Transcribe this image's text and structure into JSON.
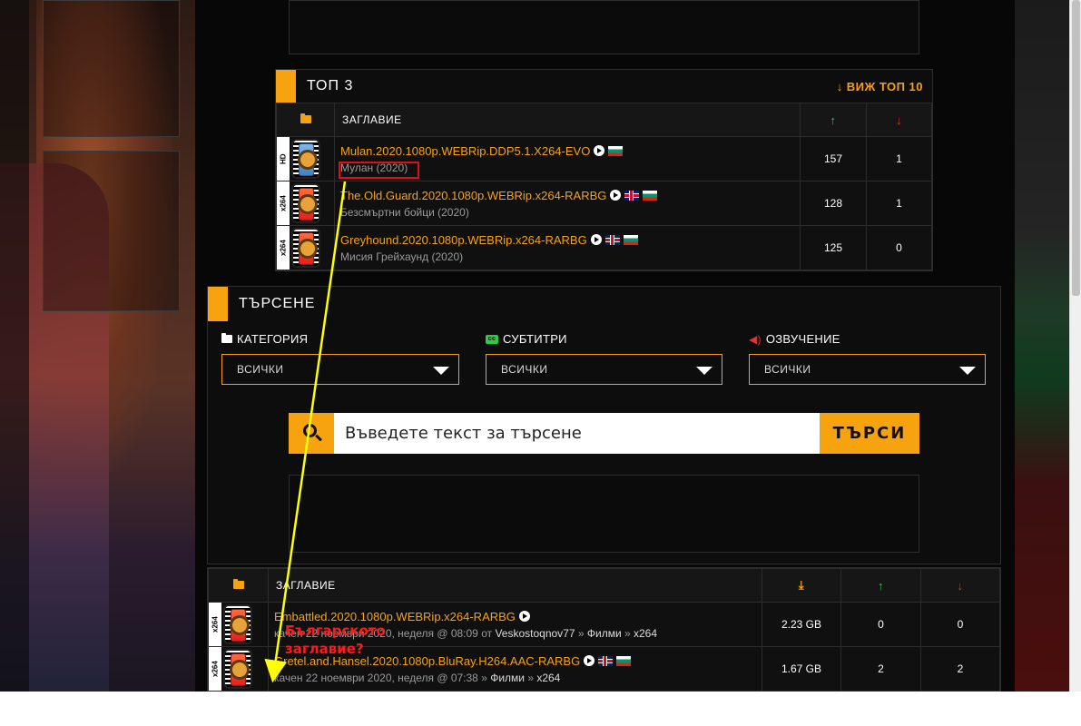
{
  "top3": {
    "title": "ТОП 3",
    "view_top10": "ВИЖ ТОП 10",
    "col_title": "ЗАГЛАВИЕ",
    "rows": [
      {
        "tag": "HD",
        "name": "Mulan.2020.1080p.WEBRip.DDP5.1.X264-EVO",
        "subtitle": "Мулан (2020)",
        "seeders": "157",
        "leechers": "1",
        "flags": [
          "bg"
        ]
      },
      {
        "tag": "x264",
        "name": "The.Old.Guard.2020.1080p.WEBRip.x264-RARBG",
        "subtitle": "Безсмъртни бойци (2020)",
        "seeders": "128",
        "leechers": "1",
        "flags": [
          "uk",
          "bg"
        ]
      },
      {
        "tag": "x264",
        "name": "Greyhound.2020.1080p.WEBRip.x264-RARBG",
        "subtitle": "Мисия Грейхаунд (2020)",
        "seeders": "125",
        "leechers": "0",
        "flags": [
          "uk",
          "bg"
        ]
      }
    ]
  },
  "search": {
    "title": "ТЪРСЕНЕ",
    "category_label": "КАТЕГОРИЯ",
    "subtitles_label": "СУБТИТРИ",
    "audio_label": "ОЗВУЧЕНИЕ",
    "category_value": "ВСИЧКИ",
    "subtitles_value": "ВСИЧКИ",
    "audio_value": "ВСИЧКИ",
    "placeholder": "Въведете текст за търсене",
    "button": "ТЪРСИ"
  },
  "list": {
    "col_title": "ЗАГЛАВИЕ",
    "rows": [
      {
        "tag": "x264",
        "name": "Embattled.2020.1080p.WEBRip.x264-RARBG",
        "meta_prefix": "качен 22 ноември 2020, неделя @ 08:09 от",
        "uploader": "Veskostoqnov77",
        "category": "Филми",
        "subcategory": "x264",
        "size": "2.23 GB",
        "seeders": "0",
        "leechers": "0"
      },
      {
        "tag": "x264",
        "name": "Gretel.and.Hansel.2020.1080p.BluRay.H264.AAC-RARBG",
        "meta_prefix": "качен 22 ноември 2020, неделя @ 07:38",
        "uploader": "",
        "category": "Филми",
        "subcategory": "x264",
        "size": "1.67 GB",
        "seeders": "2",
        "leechers": "2"
      }
    ]
  },
  "annotation": {
    "line1": "Българското",
    "line2": "заглавие?"
  },
  "colors": {
    "accent": "#f7a20f",
    "up": "#2ecc40",
    "down": "#e83030",
    "annotation": "#ff1a1a",
    "arrow": "#ffff00"
  }
}
